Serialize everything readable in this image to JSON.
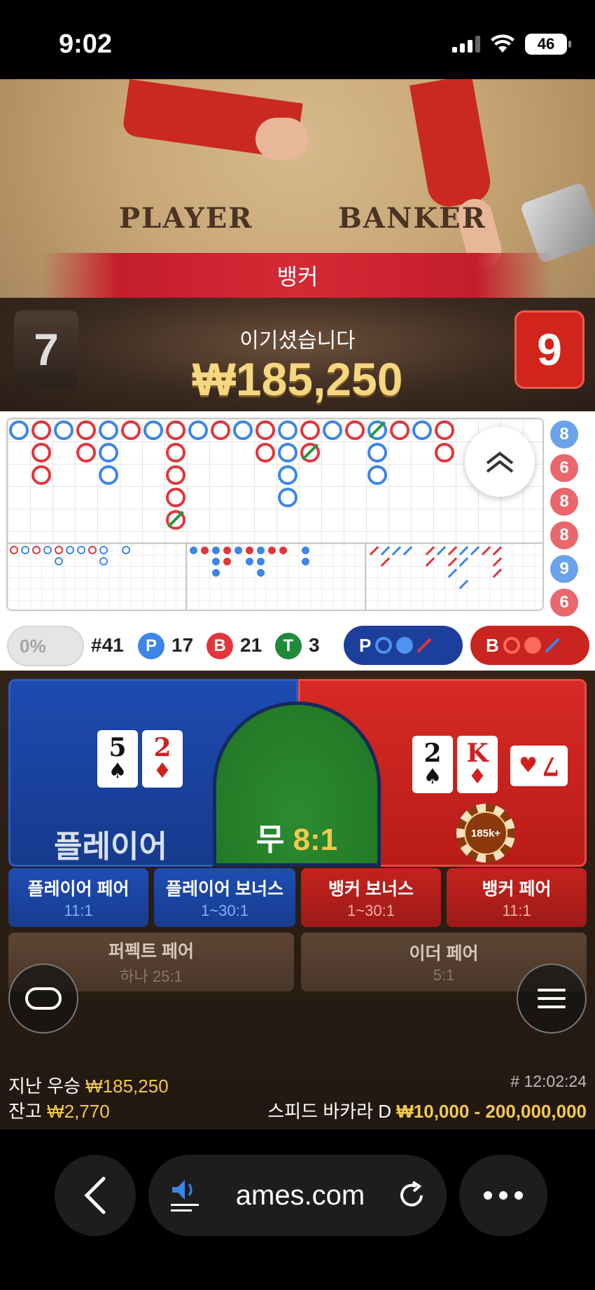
{
  "status": {
    "time": "9:02",
    "battery": "46"
  },
  "video": {
    "player_word": "PLAYER",
    "banker_word": "BANKER",
    "winner_banner": "뱅커",
    "win_title": "이기셨습니다",
    "win_amount": "₩185,250",
    "player_score": "7",
    "banker_score": "9"
  },
  "roadmap": {
    "side_numbers": [
      "8",
      "6",
      "8",
      "8",
      "9",
      "6"
    ]
  },
  "stats": {
    "percent": "0%",
    "round": "#41",
    "player_badge": "P",
    "player_count": "17",
    "banker_badge": "B",
    "banker_count": "21",
    "tie_badge": "T",
    "tie_count": "3",
    "predict_player": "P",
    "predict_banker": "B"
  },
  "betting": {
    "player_label": "플레이어",
    "tie_label": "무",
    "tie_odds": "8:1",
    "chip_label": "185k+",
    "player_cards": [
      {
        "rank": "5",
        "suit": "♠"
      },
      {
        "rank": "2",
        "suit": "♦"
      }
    ],
    "banker_cards": [
      {
        "rank": "2",
        "suit": "♠"
      },
      {
        "rank": "K",
        "suit": "♦"
      },
      {
        "rank": "7",
        "suit": "♥"
      }
    ],
    "side_bets": [
      {
        "title": "플레이어 페어",
        "odds": "11:1"
      },
      {
        "title": "플레이어 보너스",
        "odds": "1~30:1"
      },
      {
        "title": "뱅커 보너스",
        "odds": "1~30:1"
      },
      {
        "title": "뱅커 페어",
        "odds": "11:1"
      },
      {
        "title": "퍼펙트 페어",
        "odds": "하나 25:1"
      },
      {
        "title": "이더 페어",
        "odds": "5:1"
      }
    ],
    "last_win_label": "지난 우승",
    "last_win_value": "₩185,250",
    "balance_label": "잔고",
    "balance_value": "₩2,770",
    "round_id": "# 12:02:24",
    "table_name": "스피드 바카라 D",
    "limits": "₩10,000 - 200,000,000"
  },
  "browser": {
    "url": "ames.com"
  }
}
